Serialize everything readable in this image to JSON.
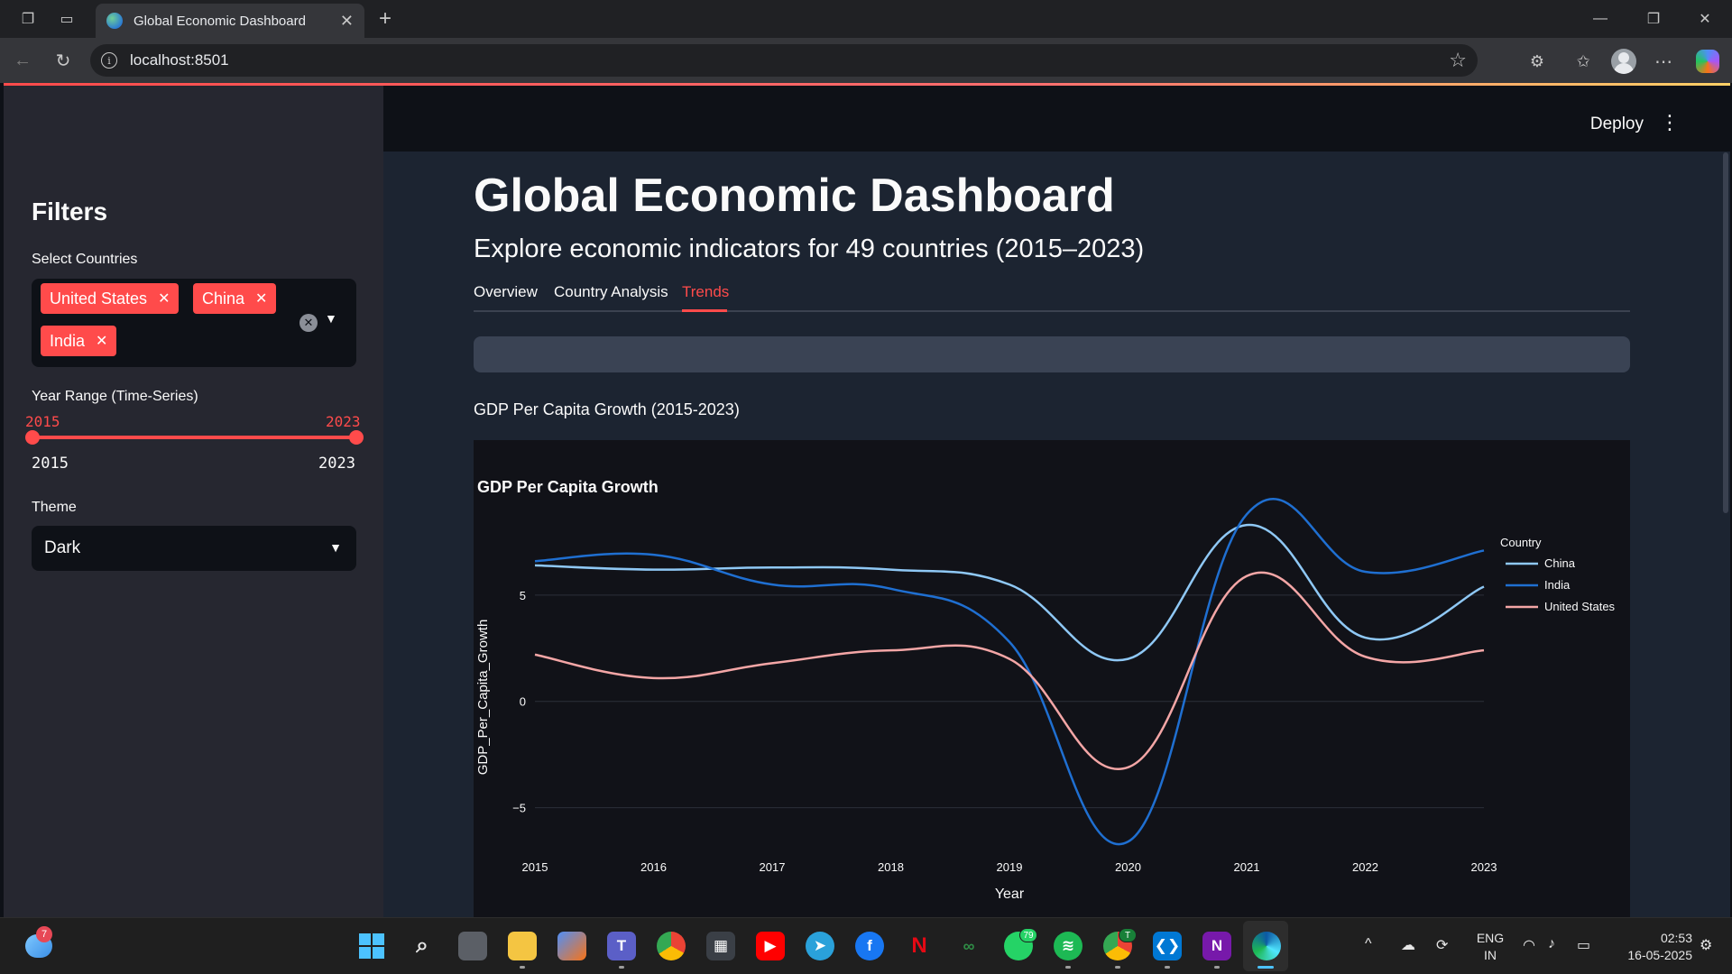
{
  "browser": {
    "tab_title": "Global Economic Dashboard",
    "url": "localhost:8501"
  },
  "app": {
    "header": {
      "deploy_label": "Deploy"
    },
    "sidebar": {
      "title": "Filters",
      "countries_label": "Select Countries",
      "selected_countries": [
        "United States",
        "China",
        "India"
      ],
      "year_range_label": "Year Range (Time-Series)",
      "year_range_value": [
        "2015",
        "2023"
      ],
      "year_min": "2015",
      "year_max": "2023",
      "theme_label": "Theme",
      "theme_value": "Dark"
    },
    "main": {
      "title": "Global Economic Dashboard",
      "subtitle": "Explore economic indicators for 49 countries (2015–2023)",
      "tabs": [
        {
          "label": "Overview",
          "active": false
        },
        {
          "label": "Country Analysis",
          "active": false
        },
        {
          "label": "Trends",
          "active": true
        }
      ],
      "chart_caption": "GDP Per Capita Growth (2015-2023)"
    }
  },
  "chart_data": {
    "type": "line",
    "title": "GDP Per Capita Growth",
    "xlabel": "Year",
    "ylabel": "GDP_Per_Capita_Growth",
    "x": [
      2015,
      2016,
      2017,
      2018,
      2019,
      2020,
      2021,
      2022,
      2023
    ],
    "ylim": [
      -6.8,
      8.9
    ],
    "yticks": [
      -5,
      0,
      5
    ],
    "legend_title": "Country",
    "legend_position": "top-right",
    "grid": true,
    "series": [
      {
        "name": "China",
        "color": "#8fc8f5",
        "values": [
          6.4,
          6.2,
          6.3,
          6.2,
          5.5,
          2.0,
          8.3,
          3.0,
          5.4
        ]
      },
      {
        "name": "India",
        "color": "#1f6fd1",
        "values": [
          6.6,
          6.9,
          5.5,
          5.3,
          2.8,
          -6.6,
          8.8,
          6.1,
          7.1
        ]
      },
      {
        "name": "United States",
        "color": "#f4a6a6",
        "values": [
          2.2,
          1.1,
          1.8,
          2.4,
          2.0,
          -3.1,
          5.9,
          2.1,
          2.4
        ]
      }
    ]
  },
  "taskbar": {
    "weather_badge": "7",
    "whatsapp_badge": "79",
    "chrome_badge": "T",
    "language": "ENG",
    "region": "IN",
    "time": "02:53",
    "date": "16-05-2025"
  }
}
